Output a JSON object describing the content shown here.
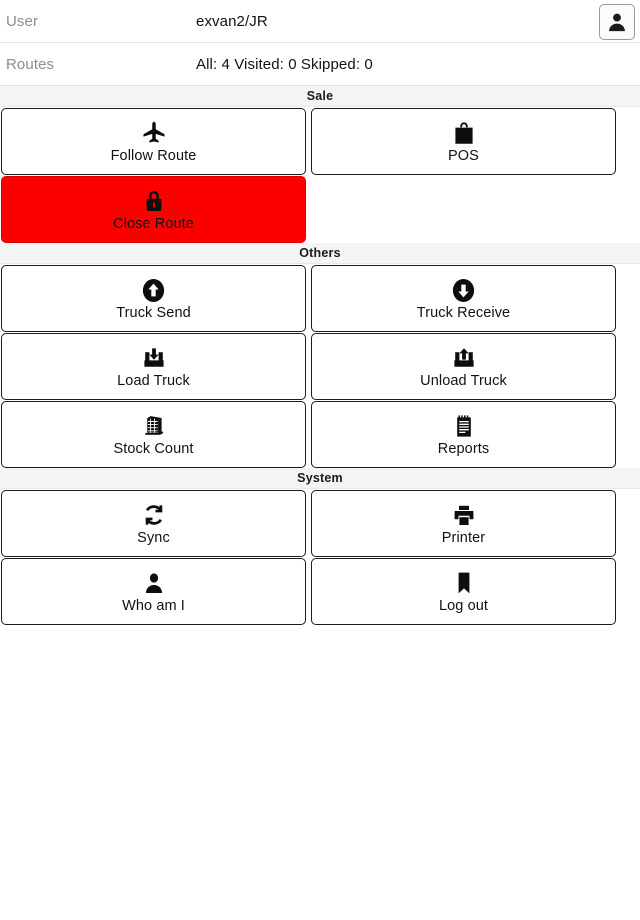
{
  "header": {
    "user_label": "User",
    "user_value": "exvan2/JR",
    "routes_label": "Routes",
    "routes_value": "All: 4 Visited: 0 Skipped: 0",
    "avatar_icon": "user-avatar-icon"
  },
  "sections": [
    {
      "title": "Sale",
      "tiles": [
        {
          "label": "Follow Route",
          "icon": "airplane-icon",
          "style": "normal"
        },
        {
          "label": "POS",
          "icon": "shopping-bag-icon",
          "style": "normal"
        },
        {
          "label": "Close Route",
          "icon": "lock-icon",
          "style": "danger"
        }
      ]
    },
    {
      "title": "Others",
      "tiles": [
        {
          "label": "Truck Send",
          "icon": "arrow-up-circle-icon",
          "style": "normal"
        },
        {
          "label": "Truck Receive",
          "icon": "arrow-down-circle-icon",
          "style": "normal"
        },
        {
          "label": "Load Truck",
          "icon": "box-arrow-down-icon",
          "style": "normal"
        },
        {
          "label": "Unload Truck",
          "icon": "box-arrow-up-icon",
          "style": "normal"
        },
        {
          "label": "Stock Count",
          "icon": "pallet-stack-icon",
          "style": "normal"
        },
        {
          "label": "Reports",
          "icon": "notepad-icon",
          "style": "normal"
        }
      ]
    },
    {
      "title": "System",
      "tiles": [
        {
          "label": "Sync",
          "icon": "refresh-sync-icon",
          "style": "normal"
        },
        {
          "label": "Printer",
          "icon": "printer-icon",
          "style": "normal"
        },
        {
          "label": "Who am I",
          "icon": "person-icon",
          "style": "normal"
        },
        {
          "label": "Log out",
          "icon": "bookmark-icon",
          "style": "normal"
        }
      ]
    }
  ],
  "colors": {
    "danger": "#fc0000",
    "section_band": "#f4f4f4",
    "label_gray": "#8d8d8d",
    "text_black": "#121212"
  }
}
